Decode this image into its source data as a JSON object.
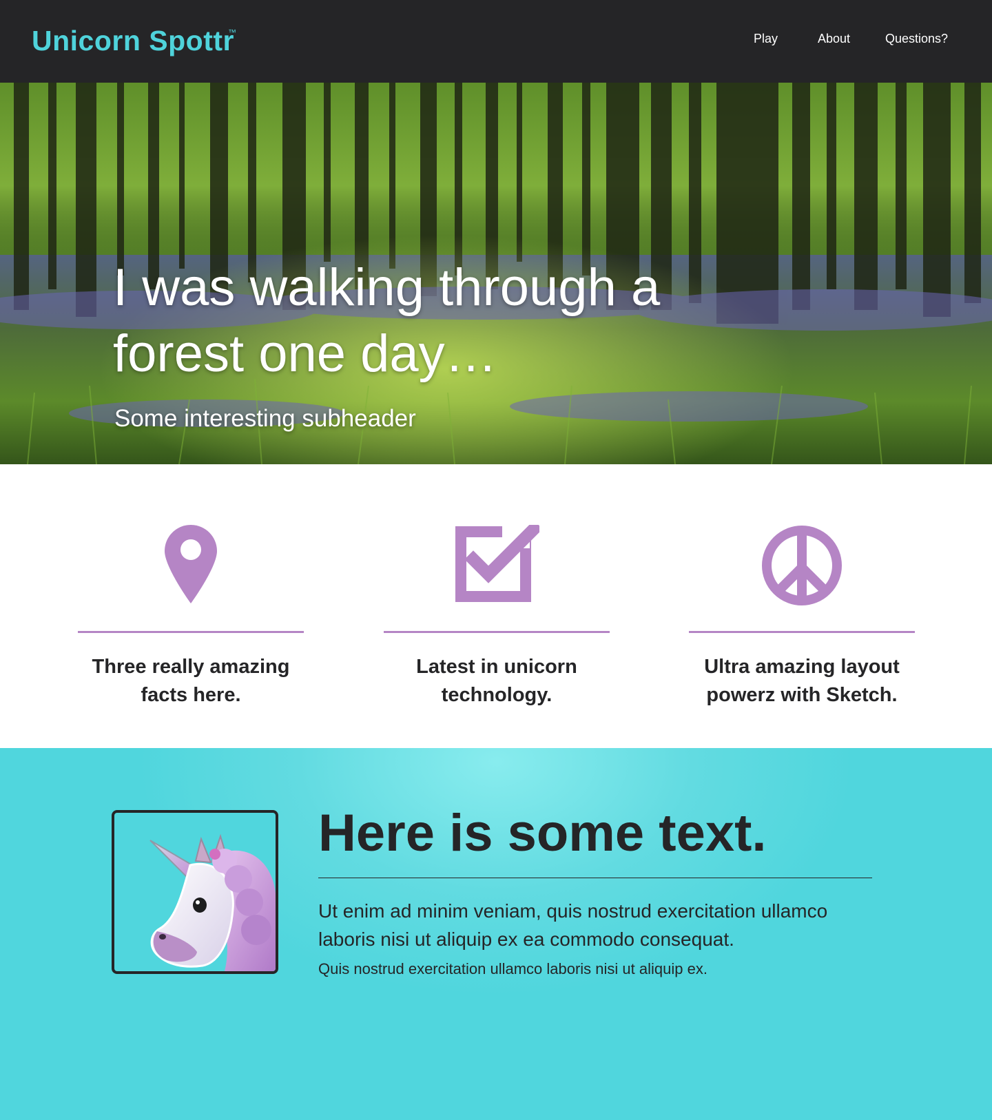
{
  "nav": {
    "brand": "Unicorn Spottr",
    "brand_tm": "™",
    "links": [
      "Play",
      "About",
      "Questions?"
    ]
  },
  "hero": {
    "title": "I was walking through a forest one day…",
    "subtitle": "Some interesting subheader"
  },
  "features": [
    {
      "icon": "map-pin-icon",
      "caption": "Three really amazing facts here."
    },
    {
      "icon": "checkbox-icon",
      "caption": "Latest in unicorn technology."
    },
    {
      "icon": "peace-icon",
      "caption": "Ultra amazing layout powerz with Sketch."
    }
  ],
  "content": {
    "image_icon": "unicorn-icon",
    "title": "Here is some text.",
    "body": "Ut enim ad minim veniam, quis nostrud exercitation ullamco laboris nisi ut aliquip ex ea commodo consequat.",
    "small": "Quis nostrud exercitation ullamco laboris nisi ut aliquip ex."
  },
  "colors": {
    "accent_teal": "#4fd3db",
    "accent_purple": "#b585c5",
    "nav_bg": "#252527",
    "text_dark": "#252527"
  }
}
